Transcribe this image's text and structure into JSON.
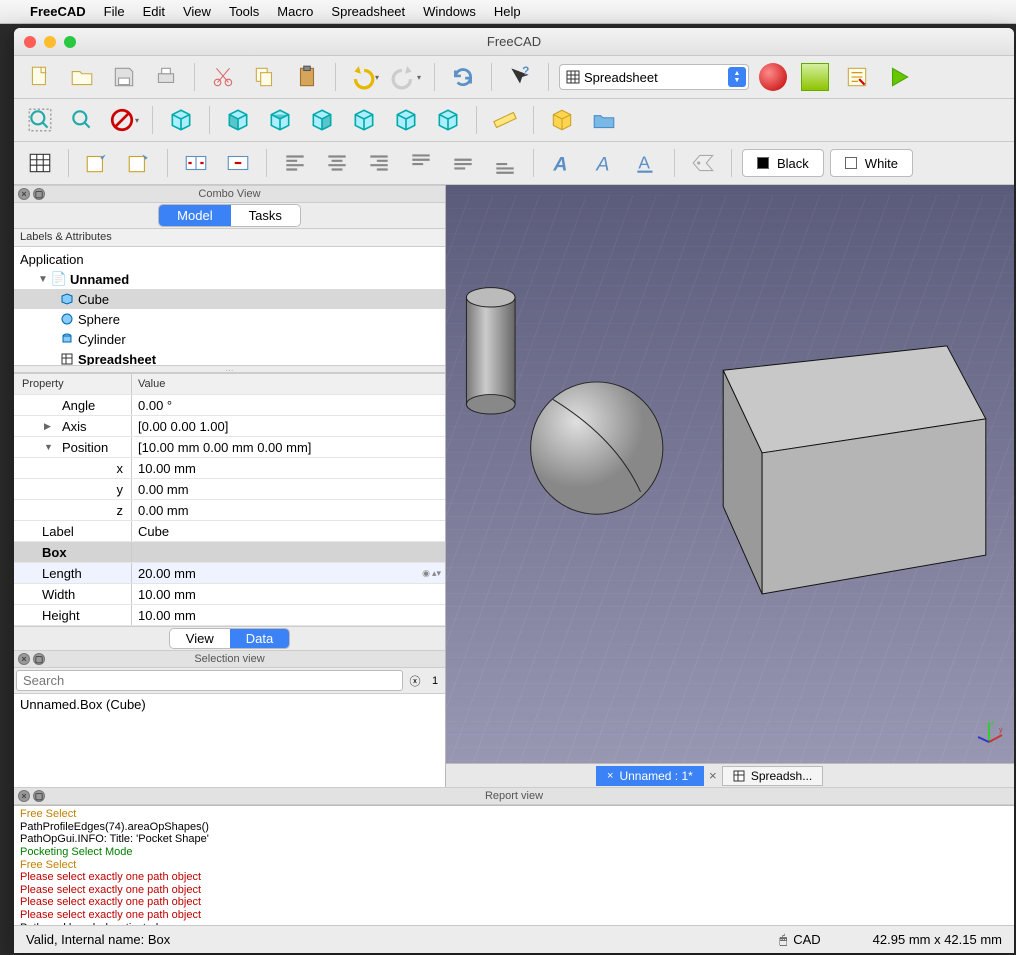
{
  "menubar": {
    "app": "FreeCAD",
    "items": [
      "File",
      "Edit",
      "View",
      "Tools",
      "Macro",
      "Spreadsheet",
      "Windows",
      "Help"
    ]
  },
  "window": {
    "title": "FreeCAD"
  },
  "workbench": {
    "selected": "Spreadsheet"
  },
  "color_buttons": {
    "black": "Black",
    "white": "White"
  },
  "combo": {
    "title": "Combo View",
    "tabs": {
      "model": "Model",
      "tasks": "Tasks"
    },
    "tree_header": "Labels & Attributes",
    "app_label": "Application",
    "doc_label": "Unnamed",
    "items": [
      {
        "label": "Cube",
        "selected": true
      },
      {
        "label": "Sphere"
      },
      {
        "label": "Cylinder"
      },
      {
        "label": "Spreadsheet"
      }
    ]
  },
  "props": {
    "header_name": "Property",
    "header_value": "Value",
    "angle": {
      "label": "Angle",
      "value": "0.00 °"
    },
    "axis": {
      "label": "Axis",
      "value": "[0.00 0.00 1.00]"
    },
    "position": {
      "label": "Position",
      "value": "[10.00 mm  0.00 mm  0.00 mm]"
    },
    "x": {
      "label": "x",
      "value": "10.00 mm"
    },
    "y": {
      "label": "y",
      "value": "0.00 mm"
    },
    "z": {
      "label": "z",
      "value": "0.00 mm"
    },
    "label": {
      "label": "Label",
      "value": "Cube"
    },
    "group": "Box",
    "length": {
      "label": "Length",
      "value": "20.00 mm"
    },
    "width": {
      "label": "Width",
      "value": "10.00 mm"
    },
    "height": {
      "label": "Height",
      "value": "10.00 mm"
    },
    "vdtabs": {
      "view": "View",
      "data": "Data"
    }
  },
  "selview": {
    "title": "Selection view",
    "placeholder": "Search",
    "count": "1",
    "item": "Unnamed.Box (Cube)"
  },
  "doctabs": {
    "active": "Unnamed : 1*",
    "other": "Spreadsh..."
  },
  "report": {
    "title": "Report view",
    "lines": [
      {
        "cls": "orange",
        "text": "Free Select"
      },
      {
        "cls": "",
        "text": "PathProfileEdges(74).areaOpShapes()"
      },
      {
        "cls": "",
        "text": "PathOpGui.INFO: Title: 'Pocket Shape'"
      },
      {
        "cls": "green",
        "text": "Pocketing Select Mode"
      },
      {
        "cls": "orange",
        "text": "Free Select"
      },
      {
        "cls": "red",
        "text": "Please select exactly one path object"
      },
      {
        "cls": "red",
        "text": "Please select exactly one path object"
      },
      {
        "cls": "red",
        "text": "Please select exactly one path object"
      },
      {
        "cls": "red",
        "text": "Please select exactly one path object"
      },
      {
        "cls": "",
        "text": "Path workbench deactivated"
      }
    ]
  },
  "status": {
    "left": "Valid, Internal name: Box",
    "mode": "CAD",
    "coords": "42.95 mm x 42.15 mm"
  }
}
